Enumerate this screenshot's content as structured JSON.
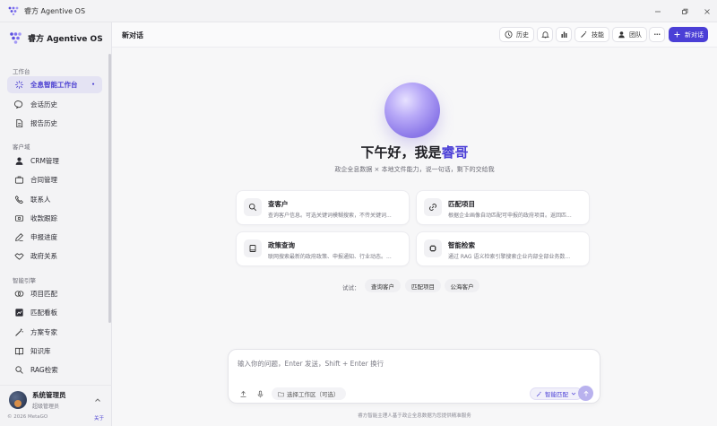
{
  "window": {
    "title": "睿方 Agentive OS",
    "controls": [
      "minimize",
      "restore",
      "close"
    ]
  },
  "sidebar": {
    "brand": "睿方 Agentive OS",
    "sections": [
      {
        "title": "工作台",
        "items": [
          {
            "label": "全息智能工作台",
            "icon": "sparkle-icon",
            "active": true,
            "badge": "•"
          },
          {
            "label": "会话历史",
            "icon": "chat-bubble-icon"
          },
          {
            "label": "报告历史",
            "icon": "document-icon"
          }
        ]
      },
      {
        "title": "客户域",
        "items": [
          {
            "label": "CRM管理",
            "icon": "user-icon"
          },
          {
            "label": "合同管理",
            "icon": "briefcase-icon"
          },
          {
            "label": "联系人",
            "icon": "phone-icon"
          },
          {
            "label": "收款跟踪",
            "icon": "money-icon"
          },
          {
            "label": "申报进度",
            "icon": "pen-icon"
          },
          {
            "label": "政府关系",
            "icon": "handshake-icon"
          }
        ]
      },
      {
        "title": "智能引擎",
        "items": [
          {
            "label": "项目匹配",
            "icon": "link-icon"
          },
          {
            "label": "匹配看板",
            "icon": "chart-board-icon"
          },
          {
            "label": "方案专家",
            "icon": "magic-wand-icon"
          },
          {
            "label": "知识库",
            "icon": "book-icon"
          },
          {
            "label": "RAG检索",
            "icon": "search-icon"
          }
        ]
      }
    ],
    "user": {
      "name": "系统管理员",
      "role": "超级管理员"
    },
    "footer": {
      "copyright": "© 2026 MetaGO",
      "about": "关于"
    }
  },
  "header": {
    "title": "新对话",
    "buttons": {
      "history": "历史",
      "skills": "技能",
      "team": "团队",
      "new_chat": "新对话",
      "more": "•••"
    }
  },
  "hero": {
    "greeting_prefix": "下午好，我是",
    "greeting_name": "睿哥",
    "subtitle": "政企全息数据 × 本地文件能力，说一句话，剩下的交给我"
  },
  "cards": [
    {
      "title": "查客户",
      "desc": "查询客户信息。可选关键词模糊搜索，不传关键词...",
      "icon": "search-icon"
    },
    {
      "title": "匹配项目",
      "desc": "根据企业画像自动匹配可申报的政府项目。返回匹...",
      "icon": "link-icon"
    },
    {
      "title": "政策查询",
      "desc": "联网搜索最新的政府政策、申报通知、行业动态。...",
      "icon": "book-icon"
    },
    {
      "title": "智能检索",
      "desc": "通过 RAG 语义检索引擎搜索企业内部全部业务数...",
      "icon": "chip-icon"
    }
  ],
  "suggestions": {
    "label": "试试：",
    "chips": [
      "查询客户",
      "匹配项目",
      "公海客户"
    ]
  },
  "composer": {
    "placeholder": "输入你的问题，Enter 发送，Shift + Enter 换行",
    "workspace": "选择工作区（可选）",
    "mode": "智能匹配"
  },
  "disclaimer": "睿方智能主理人基于政企全息数据为您提供精准服务",
  "colors": {
    "accent": "#4b3fd6",
    "active_bg": "#e4e3f3",
    "orb": "#9a88ee"
  }
}
